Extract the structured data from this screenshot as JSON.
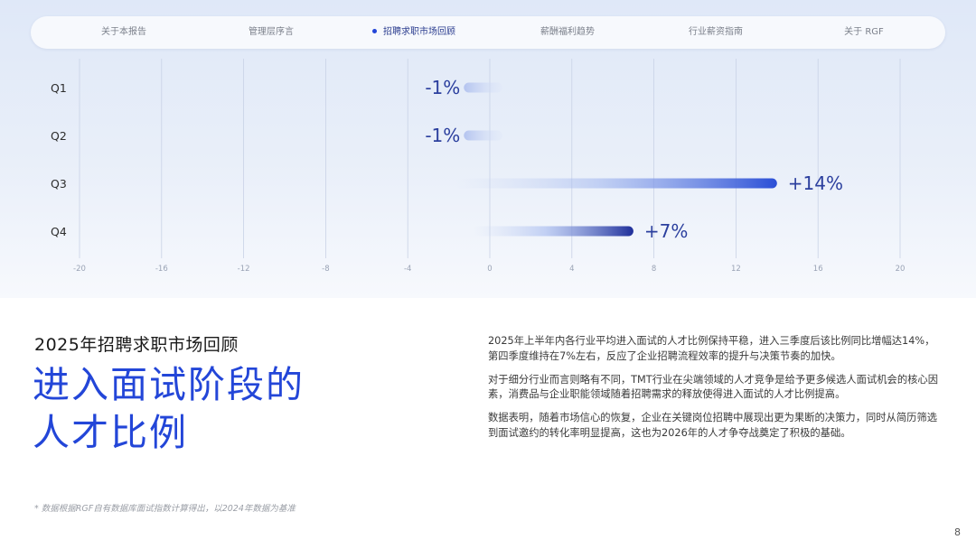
{
  "nav": {
    "items": [
      {
        "label": "关于本报告",
        "active": false
      },
      {
        "label": "管理层序言",
        "active": false
      },
      {
        "label": "招聘求职市场回顾",
        "active": true
      },
      {
        "label": "薪酬福利趋势",
        "active": false
      },
      {
        "label": "行业薪资指南",
        "active": false
      },
      {
        "label": "关于 RGF",
        "active": false
      }
    ]
  },
  "colors": {
    "accent": "#2346d8",
    "bar_end": "#2b4fd6",
    "bar_end_dark": "#1f2f9a",
    "value_label": "#2b3f9e",
    "grid": "#c9d2e6"
  },
  "chart_data": {
    "type": "bar",
    "orientation": "horizontal",
    "categories": [
      "Q1",
      "Q2",
      "Q3",
      "Q4"
    ],
    "values": [
      -1,
      -1,
      14,
      7
    ],
    "value_labels": [
      "-1%",
      "-1%",
      "+14%",
      "+7%"
    ],
    "xticks": [
      -20,
      -16,
      -12,
      -8,
      -4,
      0,
      4,
      8,
      12,
      16,
      20
    ],
    "xlim": [
      -20,
      20
    ],
    "grid": true,
    "title": "",
    "xlabel": "",
    "ylabel": ""
  },
  "section": {
    "subtitle": "2025年招聘求职市场回顾",
    "headline_line1": "进入面试阶段的",
    "headline_line2": "人才比例"
  },
  "paragraphs": [
    "2025年上半年内各行业平均进入面试的人才比例保持平稳，进入三季度后该比例同比增幅达14%，第四季度维持在7%左右，反应了企业招聘流程效率的提升与决策节奏的加快。",
    "对于细分行业而言则略有不同，TMT行业在尖端领域的人才竞争是给予更多候选人面试机会的核心因素，消费品与企业职能领域随着招聘需求的释放使得进入面试的人才比例提高。",
    "数据表明，随着市场信心的恢复，企业在关键岗位招聘中展现出更为果断的决策力，同时从简历筛选到面试邀约的转化率明显提高，这也为2026年的人才争夺战奠定了积极的基础。"
  ],
  "footnote": "* 数据根据RGF自有数据库面试指数计算得出，以2024年数据为基准",
  "page_number": "8"
}
